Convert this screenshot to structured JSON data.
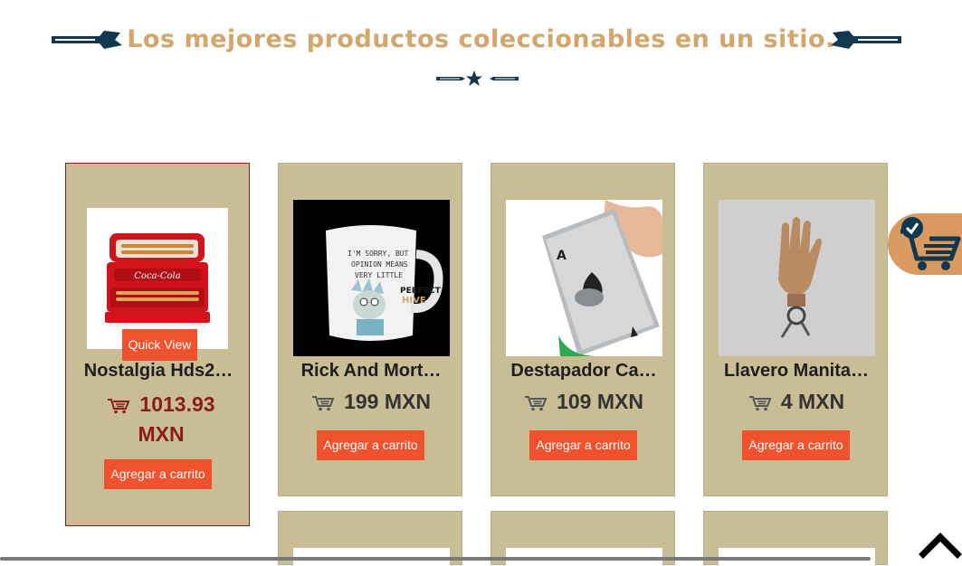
{
  "banner": {
    "title": "Los mejores productos coleccionables en un sitio."
  },
  "products": [
    {
      "name": "Nostalgia Hds2…",
      "price_line1": "1013.93",
      "price_line2": "MXN",
      "add_label": "Agregar a carrito",
      "quick_view": "Quick View"
    },
    {
      "name": "Rick And Mort…",
      "price": "199 MXN",
      "add_label": "Agregar a carrito"
    },
    {
      "name": "Destapador Ca…",
      "price": "109 MXN",
      "add_label": "Agregar a carrito"
    },
    {
      "name": "Llavero Manita…",
      "price": "4 MXN",
      "add_label": "Agregar a carrito"
    }
  ],
  "icons": {
    "cart": "shopping-cart-icon",
    "cart_fab": "cart-check-icon",
    "scroll_top": "chevron-up-icon"
  },
  "colors": {
    "card_bg": "#c9bd96",
    "accent": "#f0522d",
    "price_active": "#8a1c1c",
    "title": "#d4a66c",
    "navy": "#12384f"
  }
}
